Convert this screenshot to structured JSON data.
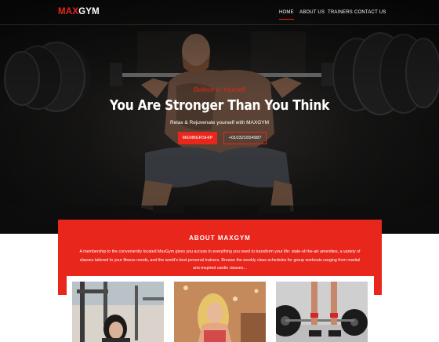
{
  "brand": {
    "prefix": "MAX",
    "suffix": "GYM",
    "accent": "#e8261c"
  },
  "nav": {
    "items": [
      {
        "label": "HOME",
        "active": true
      },
      {
        "label": "ABOUT US",
        "active": false
      },
      {
        "label": "TRAINERS",
        "active": false
      },
      {
        "label": "CONTACT US",
        "active": false
      }
    ]
  },
  "hero": {
    "tagline": "Believe in Yourself",
    "headline": "You Are Stronger Than You Think",
    "subline": "Relax & Rejuvenate yourself with MAXGYM",
    "buttons": {
      "membership": "MEMBERSHIP",
      "phone": "+010321654987"
    }
  },
  "about": {
    "title": "ABOUT MAXGYM",
    "text": "A membership to the conveniently located MaxGym gives you access to everything you need to transform your life: state-of-the-art amenities, a variety of classes tailored to your fitness needs, and the world's best personal trainers. Browse the weekly class schedules for group workouts ranging from martial arts-inspired cardio classes..."
  },
  "gallery": {
    "items": [
      {
        "icon": "woman-machine-workout-photo"
      },
      {
        "icon": "woman-blonde-gym-photo"
      },
      {
        "icon": "barbell-floor-legs-photo"
      }
    ]
  }
}
